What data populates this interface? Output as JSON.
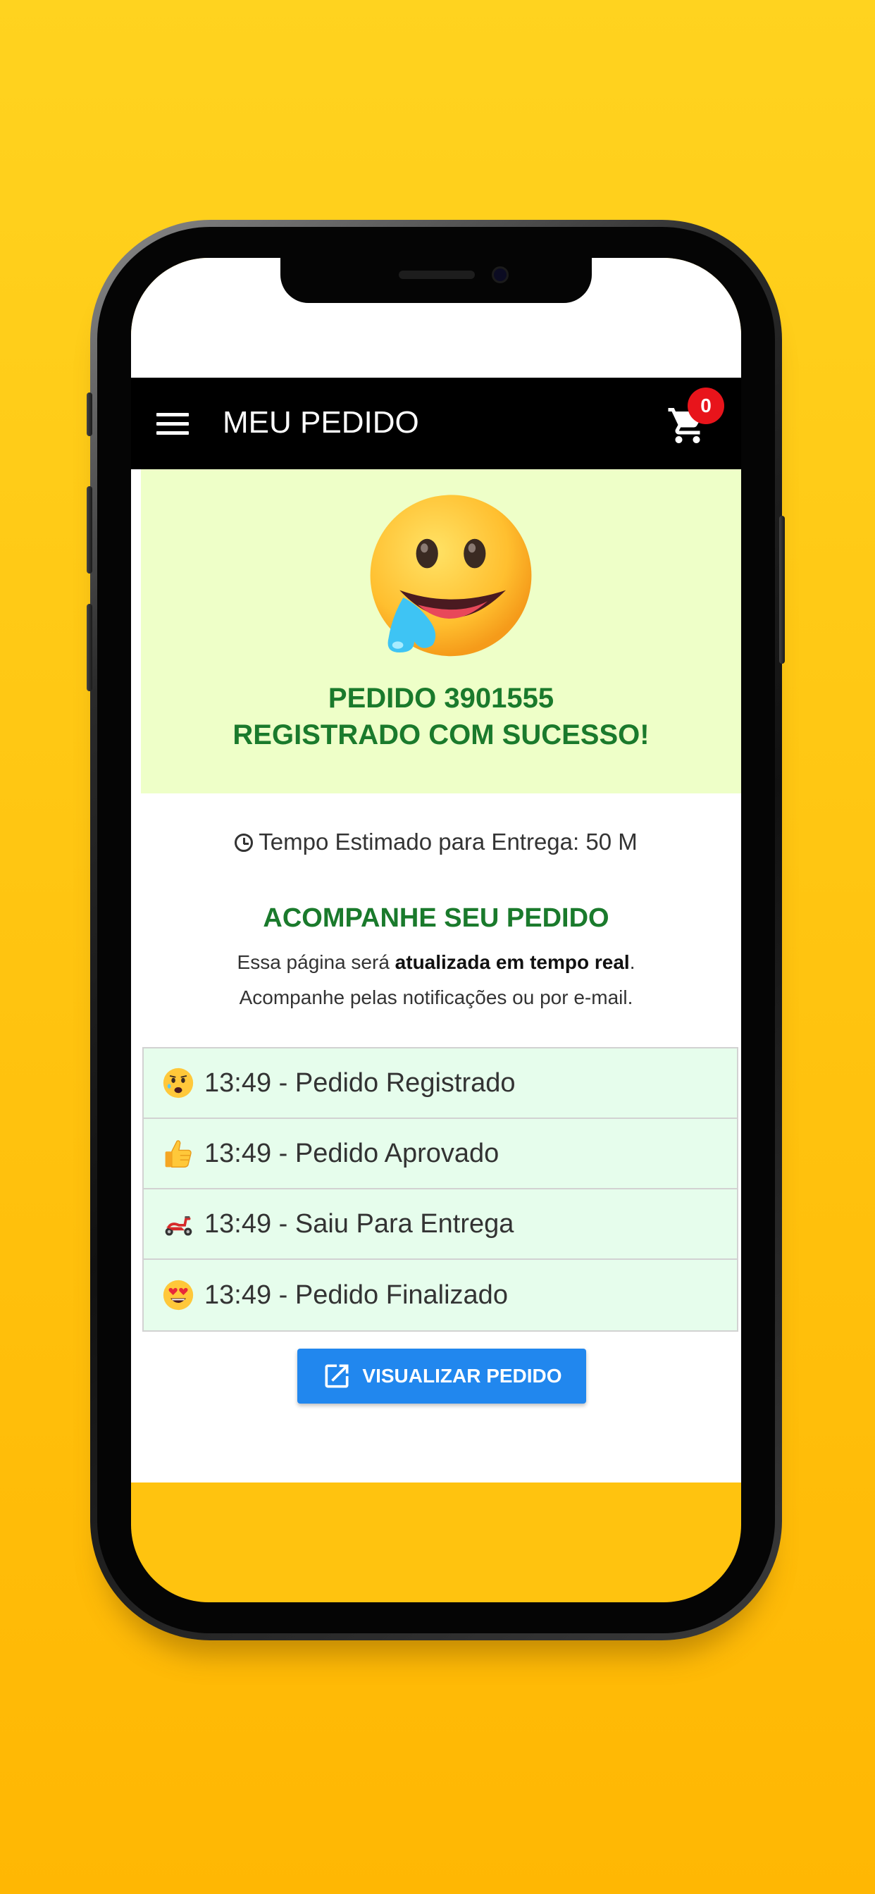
{
  "app_bar": {
    "title": "MEU PEDIDO",
    "cart_count": "0",
    "menu_icon": "hamburger-menu-icon",
    "cart_icon": "shopping-cart-icon"
  },
  "hero": {
    "emoji": "drooling-face-emoji",
    "title_line1": "PEDIDO 3901555",
    "title_line2": "REGISTRADO COM SUCESSO!"
  },
  "eta": {
    "text": "Tempo Estimado para Entrega: 50 M",
    "icon": "clock-icon"
  },
  "tracking": {
    "title": "ACOMPANHE SEU PEDIDO",
    "note_prefix": "Essa página será ",
    "note_bold": "atualizada em tempo real",
    "note_suffix": ".",
    "note_line2": "Acompanhe pelas notificações ou por e-mail."
  },
  "timeline": [
    {
      "icon": "anxious-face-icon",
      "text": "13:49 - Pedido Registrado"
    },
    {
      "icon": "thumbs-up-icon",
      "text": "13:49 - Pedido Aprovado"
    },
    {
      "icon": "scooter-icon",
      "text": "13:49 - Saiu Para Entrega"
    },
    {
      "icon": "heart-eyes-face-icon",
      "text": "13:49 - Pedido Finalizado"
    }
  ],
  "view_button": {
    "label": "VISUALIZAR PEDIDO",
    "icon": "open-in-new-icon"
  },
  "colors": {
    "background": "#ffc30f",
    "app_bar": "#000000",
    "success_green": "#1a7a2c",
    "hero_bg": "#eeffc8",
    "timeline_bg": "#e6fdec",
    "button_blue": "#2187ee",
    "badge_red": "#e8141b"
  }
}
